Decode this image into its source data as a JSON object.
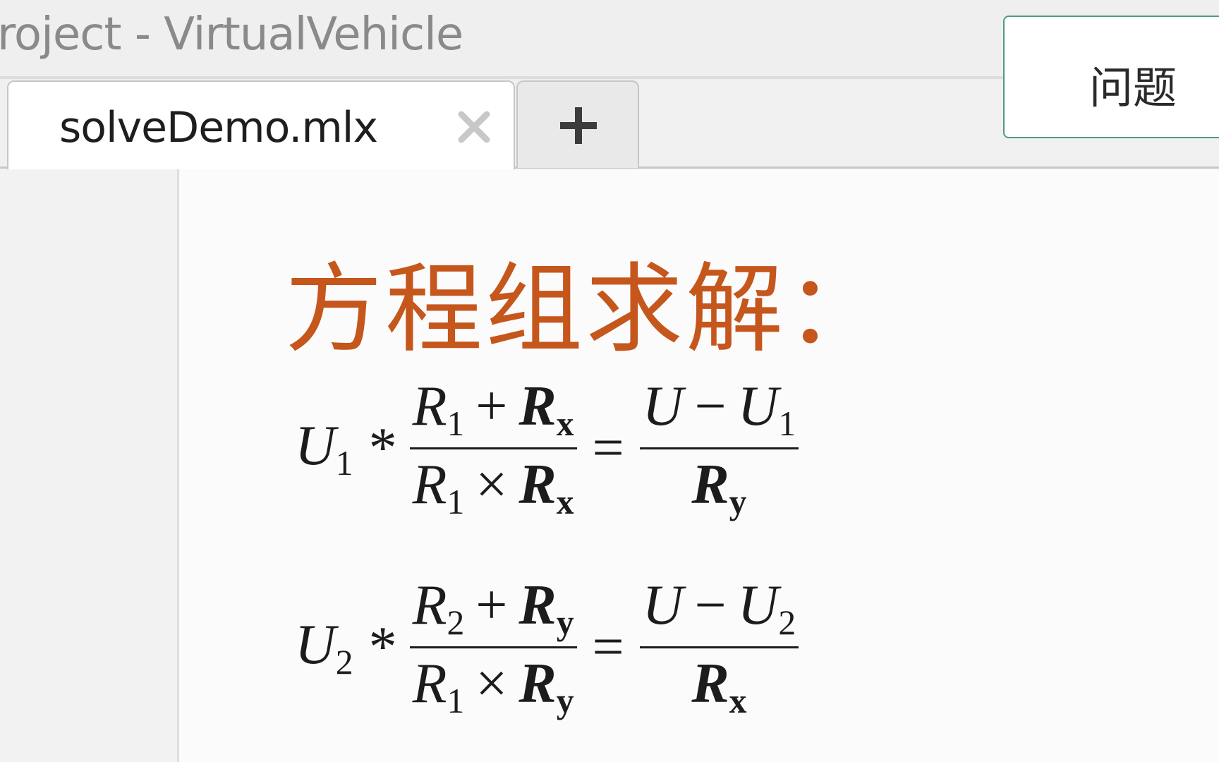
{
  "window": {
    "title": "roject - VirtualVehicle"
  },
  "issues_button": {
    "label": "问题"
  },
  "tabs": [
    {
      "label": "solveDemo.mlx",
      "close_icon": "close-icon",
      "active": true
    }
  ],
  "new_tab_icon": "plus-icon",
  "editor": {
    "heading": "方程组求解：",
    "equations": [
      {
        "lhs_var": "U",
        "lhs_sub": "1",
        "op": "*",
        "num": {
          "a": "R",
          "a_sub": "1",
          "op": "+",
          "b": "R",
          "b_sub": "x"
        },
        "den": {
          "a": "R",
          "a_sub": "1",
          "op": "×",
          "b": "R",
          "b_sub": "x"
        },
        "eq": "=",
        "rnum": {
          "a": "U",
          "op": "−",
          "b": "U",
          "b_sub": "1"
        },
        "rden": {
          "a": "R",
          "a_sub": "y"
        }
      },
      {
        "lhs_var": "U",
        "lhs_sub": "2",
        "op": "*",
        "num": {
          "a": "R",
          "a_sub": "2",
          "op": "+",
          "b": "R",
          "b_sub": "y"
        },
        "den": {
          "a": "R",
          "a_sub": "1",
          "op": "×",
          "b": "R",
          "b_sub": "y"
        },
        "eq": "=",
        "rnum": {
          "a": "U",
          "op": "−",
          "b": "U",
          "b_sub": "2"
        },
        "rden": {
          "a": "R",
          "a_sub": "x"
        }
      }
    ]
  },
  "colors": {
    "heading": "#c5561c",
    "accent_border": "#4e9a8a"
  }
}
